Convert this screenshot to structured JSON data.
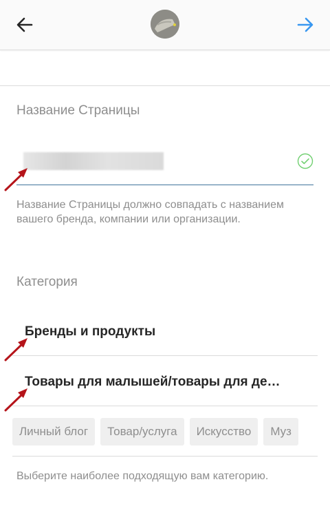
{
  "header": {
    "back_icon": "arrow-left-icon",
    "next_icon": "arrow-right-icon",
    "next_color": "#3897f0"
  },
  "page_name": {
    "label": "Название Страницы",
    "help": "Название Страницы должно совпадать с названием вашего бренда, компании или организации.",
    "valid_icon": "check-circle-icon",
    "valid_color": "#6fcf6f",
    "underline_color": "#3f729b"
  },
  "category": {
    "label": "Категория",
    "selected": [
      "Бренды и продукты",
      "Товары для малышей/товары для де…"
    ],
    "chips": [
      "Личный блог",
      "Товар/услуга",
      "Искусство",
      "Муз"
    ],
    "help": "Выберите наиболее подходящую вам категорию."
  },
  "annotation_color": "#b5141a"
}
